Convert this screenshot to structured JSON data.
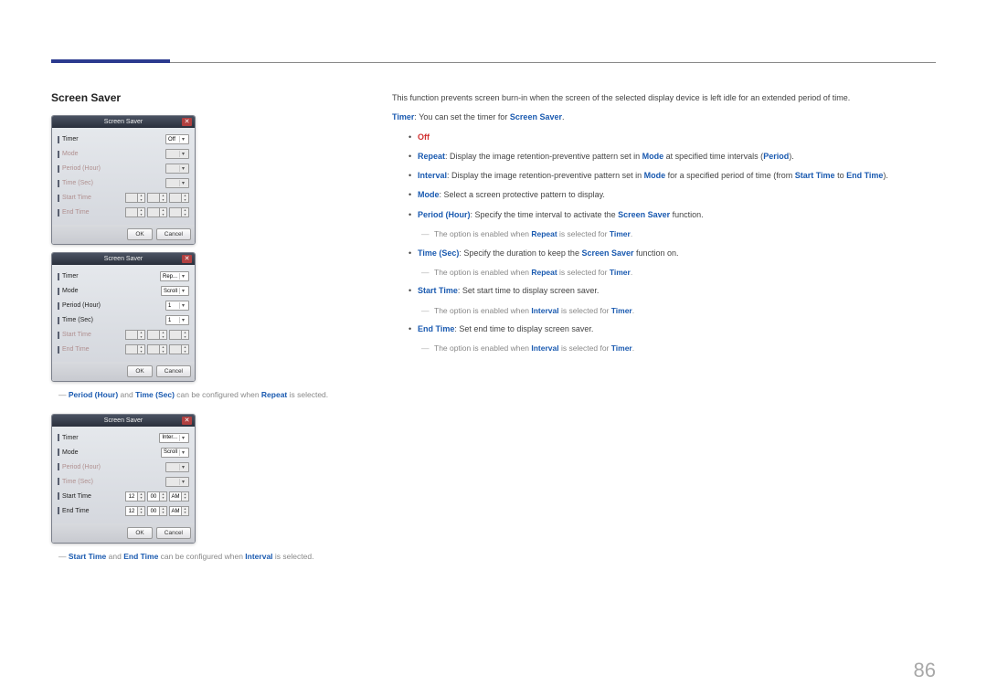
{
  "pageNumber": "86",
  "sectionTitle": "Screen Saver",
  "dialogs": [
    {
      "title": "Screen Saver",
      "rows": [
        {
          "label": "Timer",
          "disabled": false,
          "ctrl": {
            "type": "combo",
            "value": "Off"
          }
        },
        {
          "label": "Mode",
          "disabled": true,
          "ctrl": {
            "type": "combo",
            "value": "",
            "disabled": true
          }
        },
        {
          "label": "Period (Hour)",
          "disabled": true,
          "ctrl": {
            "type": "combo",
            "value": "",
            "disabled": true
          }
        },
        {
          "label": "Time (Sec)",
          "disabled": true,
          "ctrl": {
            "type": "combo",
            "value": "",
            "disabled": true
          }
        },
        {
          "label": "Start Time",
          "disabled": true,
          "ctrl": {
            "type": "time",
            "disabled": true
          }
        },
        {
          "label": "End Time",
          "disabled": true,
          "ctrl": {
            "type": "time",
            "disabled": true
          }
        }
      ],
      "ok": "OK",
      "cancel": "Cancel"
    },
    {
      "title": "Screen Saver",
      "rows": [
        {
          "label": "Timer",
          "disabled": false,
          "ctrl": {
            "type": "combo",
            "value": "Rep..."
          }
        },
        {
          "label": "Mode",
          "disabled": false,
          "ctrl": {
            "type": "combo",
            "value": "Scroll"
          }
        },
        {
          "label": "Period (Hour)",
          "disabled": false,
          "ctrl": {
            "type": "combo",
            "value": "1"
          }
        },
        {
          "label": "Time (Sec)",
          "disabled": false,
          "ctrl": {
            "type": "combo",
            "value": "1"
          }
        },
        {
          "label": "Start Time",
          "disabled": true,
          "ctrl": {
            "type": "time",
            "disabled": true
          }
        },
        {
          "label": "End Time",
          "disabled": true,
          "ctrl": {
            "type": "time",
            "disabled": true
          }
        }
      ],
      "ok": "OK",
      "cancel": "Cancel",
      "noteParts": [
        "Period (Hour)",
        " and ",
        "Time (Sec)",
        " can be configured when ",
        "Repeat",
        " is selected."
      ]
    },
    {
      "title": "Screen Saver",
      "rows": [
        {
          "label": "Timer",
          "disabled": false,
          "ctrl": {
            "type": "combo",
            "value": "Inter..."
          }
        },
        {
          "label": "Mode",
          "disabled": false,
          "ctrl": {
            "type": "combo",
            "value": "Scroll"
          }
        },
        {
          "label": "Period (Hour)",
          "disabled": true,
          "ctrl": {
            "type": "combo",
            "value": "",
            "disabled": true
          }
        },
        {
          "label": "Time (Sec)",
          "disabled": true,
          "ctrl": {
            "type": "combo",
            "value": "",
            "disabled": true
          }
        },
        {
          "label": "Start Time",
          "disabled": false,
          "ctrl": {
            "type": "time",
            "h": "12",
            "m": "00",
            "ap": "AM"
          }
        },
        {
          "label": "End Time",
          "disabled": false,
          "ctrl": {
            "type": "time",
            "h": "12",
            "m": "00",
            "ap": "AM"
          }
        }
      ],
      "ok": "OK",
      "cancel": "Cancel",
      "noteParts": [
        "Start Time",
        " and ",
        "End Time",
        " can be configured when ",
        "Interval",
        " is selected."
      ]
    }
  ],
  "right": {
    "intro": "This function prevents screen burn-in when the screen of the selected display device is left idle for an extended period of time.",
    "timerLine": {
      "term": "Timer",
      "rest": ": You can set the timer for ",
      "term2": "Screen Saver",
      "end": "."
    },
    "bullets": [
      {
        "kind": "off",
        "text": "Off"
      },
      {
        "kind": "para",
        "term": "Repeat",
        "body": ": Display the image retention-preventive pattern set in ",
        "term2": "Mode",
        "body2": " at specified time intervals (",
        "term3": "Period",
        "body3": ")."
      },
      {
        "kind": "interval",
        "term": "Interval",
        "body": ": Display the image retention-preventive pattern set in ",
        "term2": "Mode",
        "body2": " for a specified period of time (from ",
        "term3": "Start Time",
        "body3": " to ",
        "term4": "End Time",
        "body4": ")."
      },
      {
        "kind": "simple",
        "term": "Mode",
        "body": ": Select a screen protective pattern to display."
      },
      {
        "kind": "withnote",
        "term": "Period (Hour)",
        "body": ": Specify the time interval to activate the ",
        "term2": "Screen Saver",
        "body2": " function.",
        "note": {
          "pre": "The option is enabled when ",
          "t1": "Repeat",
          "mid": " is selected for ",
          "t2": "Timer",
          "post": "."
        }
      },
      {
        "kind": "withnote",
        "term": "Time (Sec)",
        "body": ": Specify the duration to keep the ",
        "term2": "Screen Saver",
        "body2": " function on.",
        "note": {
          "pre": "The option is enabled when ",
          "t1": "Repeat",
          "mid": " is selected for ",
          "t2": "Timer",
          "post": "."
        }
      },
      {
        "kind": "withnote",
        "term": "Start Time",
        "body": ": Set start time to display screen saver.",
        "note": {
          "pre": "The option is enabled when ",
          "t1": "Interval",
          "mid": " is selected for ",
          "t2": "Timer",
          "post": "."
        }
      },
      {
        "kind": "withnote",
        "term": "End Time",
        "body": ": Set end time to display screen saver.",
        "note": {
          "pre": "The option is enabled when ",
          "t1": "Interval",
          "mid": " is selected for ",
          "t2": "Timer",
          "post": "."
        }
      }
    ]
  }
}
